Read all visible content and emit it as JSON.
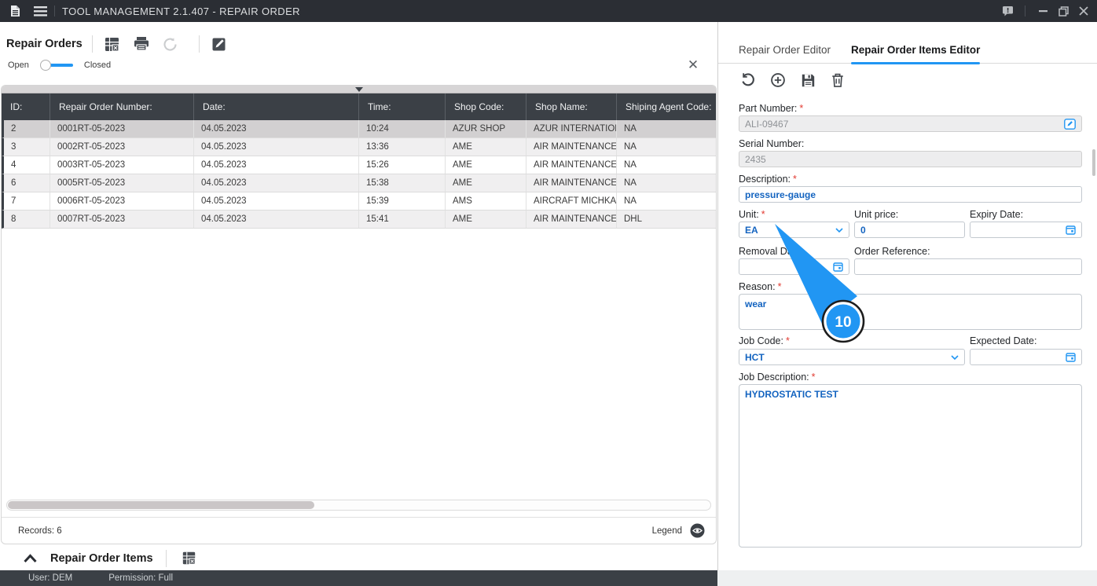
{
  "ui": {
    "required_marker": "*"
  },
  "titlebar": {
    "title": "TOOL MANAGEMENT 2.1.407 - REPAIR ORDER"
  },
  "left_panel": {
    "title": "Repair Orders",
    "toggle": {
      "open_label": "Open",
      "closed_label": "Closed"
    },
    "table": {
      "columns": [
        "ID:",
        "Repair Order Number:",
        "Date:",
        "Time:",
        "Shop Code:",
        "Shop Name:",
        "Shiping Agent Code:"
      ],
      "rows": [
        [
          "2",
          "0001RT-05-2023",
          "04.05.2023",
          "10:24",
          "AZUR SHOP",
          "AZUR INTERNATION...",
          "NA"
        ],
        [
          "3",
          "0002RT-05-2023",
          "04.05.2023",
          "13:36",
          "AME",
          "AIR MAINTENANCE E...",
          "NA"
        ],
        [
          "4",
          "0003RT-05-2023",
          "04.05.2023",
          "15:26",
          "AME",
          "AIR MAINTENANCE E...",
          "NA"
        ],
        [
          "6",
          "0005RT-05-2023",
          "04.05.2023",
          "15:38",
          "AME",
          "AIR MAINTENANCE E...",
          "NA"
        ],
        [
          "7",
          "0006RT-05-2023",
          "04.05.2023",
          "15:39",
          "AMS",
          "AIRCRAFT MICHKAS...",
          "NA"
        ],
        [
          "8",
          "0007RT-05-2023",
          "04.05.2023",
          "15:41",
          "AME",
          "AIR MAINTENANCE E...",
          "DHL"
        ]
      ],
      "selected_row_index": 0,
      "records_label": "Records: 6",
      "legend_label": "Legend"
    },
    "section_title": "Repair Order Items"
  },
  "right_panel": {
    "tabs": [
      {
        "label": "Repair Order Editor",
        "active": false
      },
      {
        "label": "Repair Order Items Editor",
        "active": true
      }
    ],
    "form": {
      "part_number": {
        "label": "Part Number:",
        "required": true,
        "value": "ALI-09467"
      },
      "serial_number": {
        "label": "Serial Number:",
        "required": false,
        "value": "2435"
      },
      "description": {
        "label": "Description:",
        "required": true,
        "value": "pressure-gauge"
      },
      "unit": {
        "label": "Unit:",
        "required": true,
        "value": "EA"
      },
      "unit_price": {
        "label": "Unit price:",
        "required": false,
        "value": "0"
      },
      "expiry_date": {
        "label": "Expiry Date:",
        "required": false,
        "value": ""
      },
      "removal_date": {
        "label": "Removal Date:",
        "required": false,
        "value": ""
      },
      "order_reference": {
        "label": "Order Reference:",
        "required": false,
        "value": ""
      },
      "reason": {
        "label": "Reason:",
        "required": true,
        "value": "wear"
      },
      "job_code": {
        "label": "Job Code:",
        "required": true,
        "value": "HCT"
      },
      "expected_date": {
        "label": "Expected Date:",
        "required": false,
        "value": ""
      },
      "job_description": {
        "label": "Job Description:",
        "required": true,
        "value": "HYDROSTATIC TEST"
      }
    }
  },
  "statusbar": {
    "user": "User: DEM",
    "permission": "Permission: Full"
  },
  "overlay": {
    "badge": "10"
  },
  "colors": {
    "accent": "#2196f3",
    "value_text": "#1464c0",
    "header_bg": "#3b4046",
    "titlebar_bg": "#2b2e34",
    "required": "#e23b32"
  }
}
